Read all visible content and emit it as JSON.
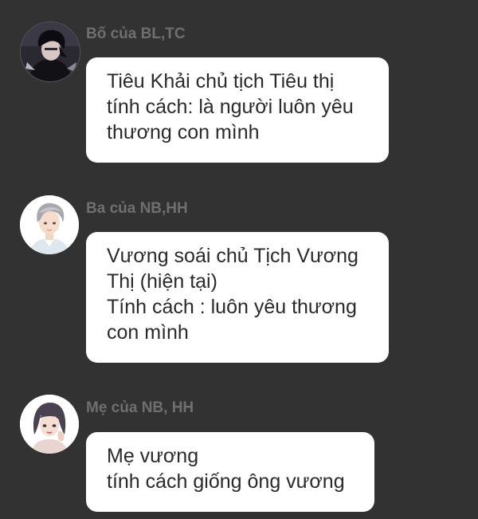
{
  "messages": [
    {
      "sender": "Bố của BL,TC",
      "avatar_icon": "dark-haired-man-avatar-icon",
      "text": "Tiêu Khải chủ tịch Tiêu thị\ntính cách: là người luôn yêu\nthương con mình"
    },
    {
      "sender": "Ba của NB,HH",
      "avatar_icon": "silver-haired-man-avatar-icon",
      "text": "Vương soái chủ Tịch Vương\nThị (hiện tại)\nTính cách : luôn yêu thương\ncon mình"
    },
    {
      "sender": "Mẹ của NB, HH",
      "avatar_icon": "dark-haired-woman-avatar-icon",
      "text": "Mẹ vương\ntính cách giống ông vương"
    }
  ],
  "colors": {
    "background": "#323232",
    "bubble": "#ffffff",
    "sender_name": "#6f6f6f",
    "message_text": "#2a2a2a"
  }
}
